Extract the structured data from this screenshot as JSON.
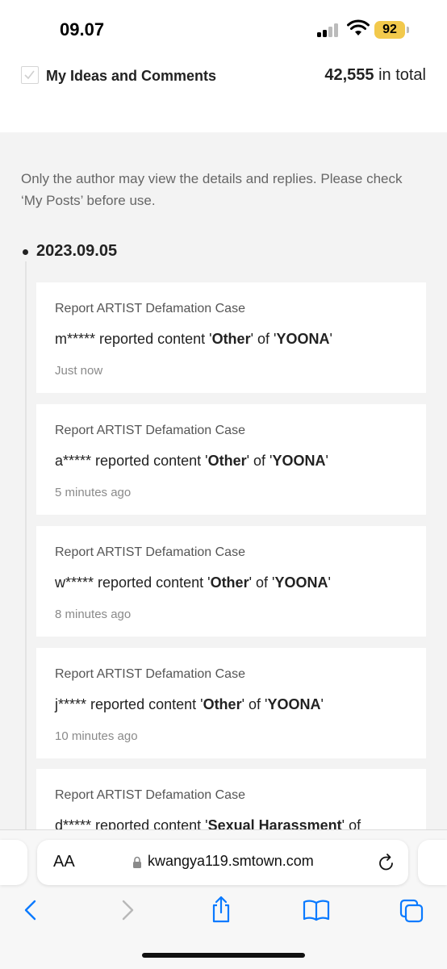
{
  "status_bar": {
    "time": "09.07",
    "battery": "92"
  },
  "header": {
    "title": "My Ideas and Comments",
    "total_count": "42,555",
    "total_suffix": " in total"
  },
  "notice": "Only the author may view the details and replies. Please check ‘My Posts’ before use.",
  "date_group": "2023.09.05",
  "items": [
    {
      "title": "Report ARTIST Defamation Case",
      "user": "m*****",
      "pre": " reported content '",
      "category": "Other",
      "mid": "' of '",
      "artist": "YOONA",
      "post": "'",
      "time": "Just now"
    },
    {
      "title": "Report ARTIST Defamation Case",
      "user": "a*****",
      "pre": " reported content '",
      "category": "Other",
      "mid": "' of '",
      "artist": "YOONA",
      "post": "'",
      "time": "5 minutes ago"
    },
    {
      "title": "Report ARTIST Defamation Case",
      "user": "w*****",
      "pre": " reported content '",
      "category": "Other",
      "mid": "' of '",
      "artist": "YOONA",
      "post": "'",
      "time": "8 minutes ago"
    },
    {
      "title": "Report ARTIST Defamation Case",
      "user": "j*****",
      "pre": " reported content '",
      "category": "Other",
      "mid": "' of '",
      "artist": "YOONA",
      "post": "'",
      "time": "10 minutes ago"
    },
    {
      "title": "Report ARTIST Defamation Case",
      "user": "d*****",
      "pre": " reported content '",
      "category": "Sexual Harassment",
      "mid": "' of",
      "artist": "",
      "post": "",
      "time": ""
    }
  ],
  "browser": {
    "text_size_label": "AA",
    "url": "kwangya119.smtown.com"
  },
  "icons": {
    "checkbox": "checkmark-icon",
    "back": "chevron-left-icon",
    "forward": "chevron-right-icon",
    "share": "share-icon",
    "bookmarks": "book-icon",
    "tabs": "tabs-icon",
    "reload": "reload-icon",
    "lock": "lock-icon"
  },
  "colors": {
    "accent_blue": "#0a7aff",
    "battery": "#f2c94c",
    "background": "#f3f3f3"
  }
}
